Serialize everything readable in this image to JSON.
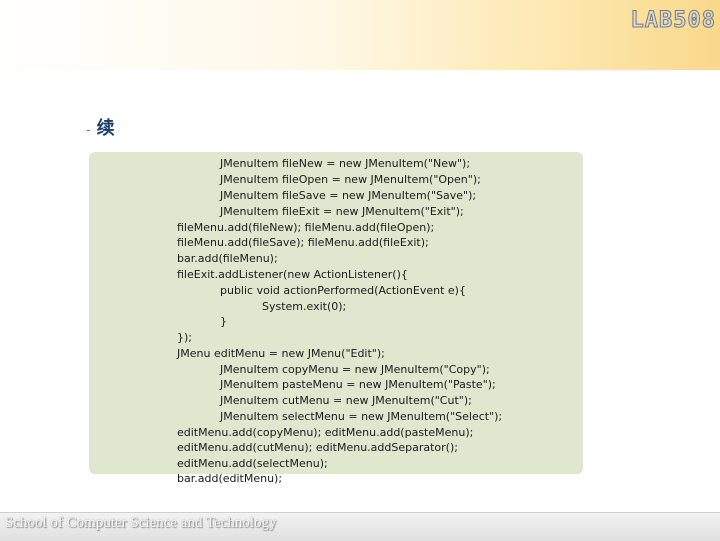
{
  "header": {
    "logo_text": "LAB508"
  },
  "slide": {
    "bullet": "-",
    "heading": "续"
  },
  "code": {
    "lines": [
      "JMenuItem fileNew = new JMenuItem(\"New\");",
      "JMenuItem fileOpen = new JMenuItem(\"Open\");",
      "JMenuItem fileSave = new JMenuItem(\"Save\");",
      "JMenuItem fileExit = new JMenuItem(\"Exit\");",
      "fileMenu.add(fileNew); fileMenu.add(fileOpen);",
      "fileMenu.add(fileSave); fileMenu.add(fileExit);",
      "bar.add(fileMenu);",
      "fileExit.addListener(new ActionListener(){",
      "public void actionPerformed(ActionEvent e){",
      "System.exit(0);",
      "}",
      "});",
      "JMenu editMenu = new JMenu(\"Edit\");",
      "JMenuItem copyMenu = new JMenuItem(\"Copy\");",
      "JMenuItem pasteMenu = new JMenuItem(\"Paste\");",
      "JMenuItem cutMenu = new JMenuItem(\"Cut\");",
      "JMenuItem selectMenu = new JMenuItem(\"Select\");",
      "editMenu.add(copyMenu); editMenu.add(pasteMenu);",
      "editMenu.add(cutMenu); editMenu.addSeparator();",
      "editMenu.add(selectMenu);",
      "bar.add(editMenu);"
    ]
  },
  "footer": {
    "text": "School of Computer Science and Technology"
  }
}
